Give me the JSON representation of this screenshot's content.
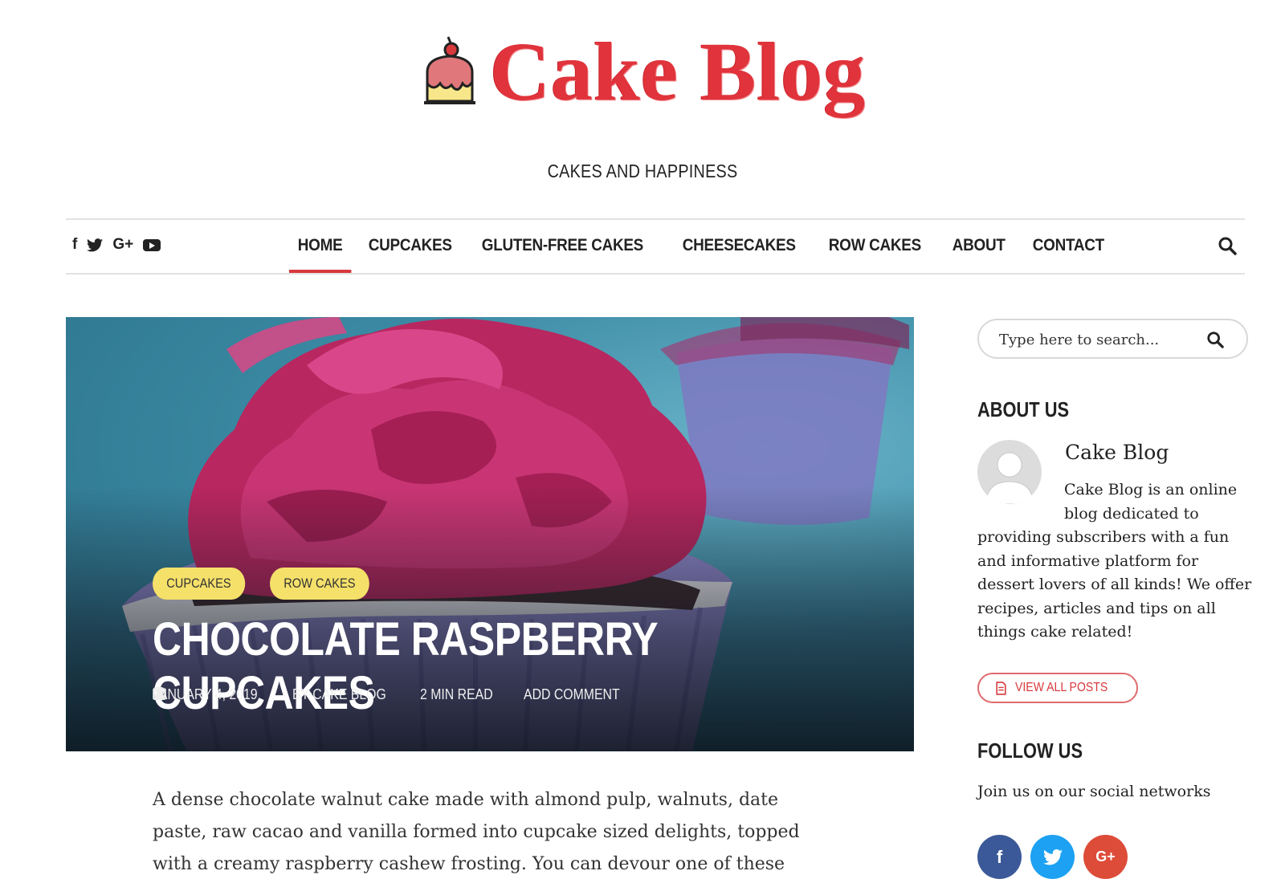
{
  "site": {
    "title": "Cake Blog",
    "tagline": "CAKES AND HAPPINESS",
    "logo_icon": "cake-logo-icon"
  },
  "colors": {
    "accent": "#d7393d",
    "badge": "#f5e06a",
    "facebook": "#3b5998",
    "twitter": "#1da1f2",
    "googleplus": "#dd4b39"
  },
  "nav": {
    "social": [
      "facebook-icon",
      "twitter-icon",
      "google-plus-icon",
      "youtube-icon"
    ],
    "social_glyphs": {
      "facebook": "f",
      "googleplus": "G+"
    },
    "items": [
      {
        "label": "HOME",
        "active": true
      },
      {
        "label": "CUPCAKES",
        "active": false
      },
      {
        "label": "GLUTEN-FREE CAKES",
        "active": false
      },
      {
        "label": "CHEESECAKES",
        "active": false
      },
      {
        "label": "ROW CAKES",
        "active": false
      },
      {
        "label": "ABOUT",
        "active": false
      },
      {
        "label": "CONTACT",
        "active": false
      }
    ]
  },
  "featured": {
    "badges": [
      "CUPCAKES",
      "ROW CAKES"
    ],
    "title": "CHOCOLATE RASPBERRY CUPCAKES",
    "date": "JANUARY 4, 2019",
    "author": "BY CAKE BLOG",
    "read_time": "2 MIN READ",
    "comments": "ADD COMMENT",
    "excerpt": "A dense chocolate walnut cake made with almond pulp, walnuts, date paste, raw cacao and vanilla formed into cupcake sized delights, topped with a creamy raspberry cashew frosting. You can devour one of these sweet treats..."
  },
  "sidebar": {
    "search_placeholder": "Type here to search...",
    "about_heading": "ABOUT US",
    "about_name": "Cake Blog",
    "about_text": "Cake Blog is an online blog dedicated to providing subscribers with a fun and informative platform for dessert lovers of all kinds! We offer recipes, articles and tips on all things cake related!",
    "view_all": "VIEW ALL POSTS",
    "follow_heading": "FOLLOW US",
    "follow_text": "Join us on our social networks",
    "social": [
      {
        "name": "facebook",
        "glyph": "f"
      },
      {
        "name": "twitter",
        "glyph": ""
      },
      {
        "name": "google-plus",
        "glyph": "G+"
      }
    ]
  }
}
